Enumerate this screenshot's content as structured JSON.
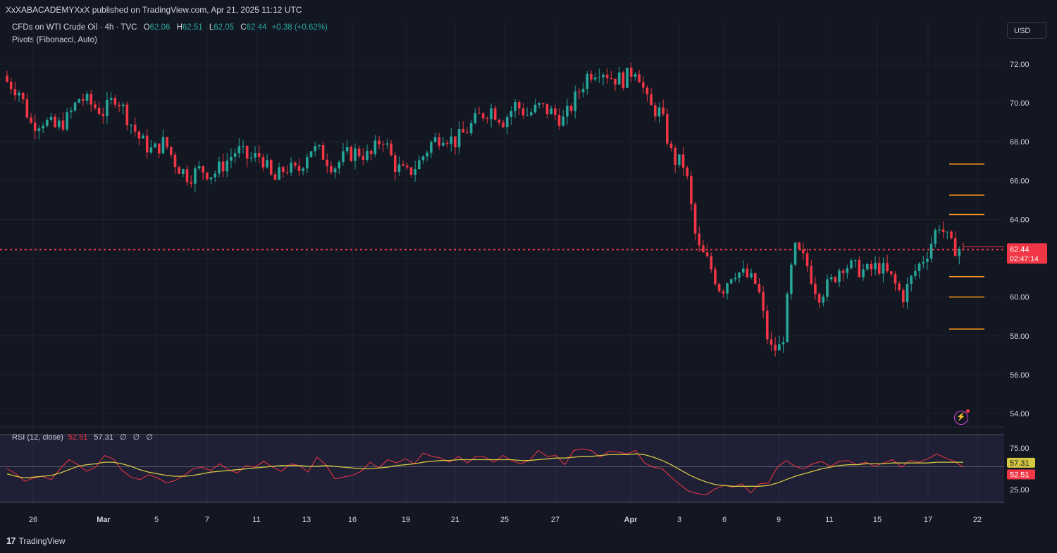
{
  "header": {
    "published": "XxXABACADEMYXxX published on TradingView.com, Apr 21, 2025 11:12 UTC"
  },
  "legend": {
    "symbol": "CFDs on WTI Crude Oil · 4h · TVC",
    "open_label": "O",
    "open": "62.06",
    "high_label": "H",
    "high": "62.51",
    "low_label": "L",
    "low": "62.05",
    "close_label": "C",
    "close": "62.44",
    "change": "+0.38 (+0.62%)",
    "pivots": "Pivots (Fibonacci, Auto)"
  },
  "currency_button": "USD",
  "price_badge": {
    "price": "62.44",
    "countdown": "02:47:14"
  },
  "rsi_legend": {
    "label": "RSI (12, close)",
    "value": "52.51",
    "ma": "57.31",
    "z1": "∅",
    "z2": "∅",
    "z3": "∅"
  },
  "brand": {
    "name": "TradingView",
    "logo_glyph": "17"
  },
  "colors": {
    "up": "#26a69a",
    "down": "#f23645",
    "pivot": "#f7931a",
    "rsi": "#f23645",
    "rsi_ma": "#d4c842",
    "background": "#131722",
    "grid": "#1e222d"
  },
  "chart_data": [
    {
      "type": "candlestick",
      "title": "CFDs on WTI Crude Oil · 4h · TVC",
      "x_ticks": [
        "26",
        "Mar",
        "5",
        "7",
        "11",
        "13",
        "16",
        "19",
        "21",
        "25",
        "27",
        "Apr",
        "3",
        "6",
        "9",
        "11",
        "15",
        "17",
        "22"
      ],
      "y_ticks": [
        "72.00",
        "70.00",
        "68.00",
        "66.00",
        "64.00",
        "62.00",
        "60.00",
        "58.00",
        "56.00",
        "54.00"
      ],
      "ylim": [
        53.4,
        73.5
      ],
      "last_price": 62.44,
      "pivot_levels": [
        66.85,
        65.25,
        64.25,
        61.05,
        60.0,
        58.35
      ],
      "series_close_path": [
        71.1,
        70.6,
        68.9,
        69.1,
        68.7,
        69.2,
        70.3,
        69.9,
        69.5,
        70.4,
        69.2,
        68.1,
        67.5,
        68.0,
        66.8,
        66.2,
        66.6,
        66.3,
        66.9,
        67.6,
        67.1,
        67.3,
        65.9,
        66.7,
        66.4,
        67.7,
        67.4,
        66.7,
        67.3,
        67.5,
        67.2,
        68.3,
        66.8,
        66.3,
        66.9,
        67.9,
        68.4,
        68.0,
        68.6,
        69.3,
        69.7,
        69.1,
        69.9,
        69.4,
        69.8,
        69.5,
        69.1,
        70.3,
        71.5,
        71.8,
        71.3,
        71.2,
        71.9,
        69.8,
        69.5,
        67.1,
        66.8,
        62.6,
        61.7,
        60.3,
        61.4,
        61.1,
        60.6,
        57.3,
        57.4,
        62.5,
        61.8,
        60.1,
        60.7,
        61.7,
        61.5,
        61.3,
        61.6,
        61.0,
        60.0,
        61.3,
        62.3,
        63.8,
        62.6,
        62.44
      ],
      "rsi": {
        "label": "RSI (12, close)",
        "y_ticks": [
          "75.00",
          "25.00"
        ],
        "ylim": [
          5,
          90
        ],
        "value": 52.51,
        "ma": 57.31,
        "values": [
          50,
          44,
          35,
          39,
          41,
          37,
          50,
          61,
          55,
          47,
          52,
          66,
          62,
          48,
          40,
          37,
          43,
          39,
          33,
          36,
          42,
          50,
          52,
          48,
          56,
          49,
          45,
          54,
          52,
          59,
          52,
          47,
          56,
          54,
          46,
          64,
          55,
          38,
          40,
          42,
          47,
          58,
          51,
          61,
          57,
          62,
          56,
          69,
          65,
          63,
          58,
          65,
          57,
          65,
          64,
          58,
          66,
          60,
          56,
          60,
          72,
          65,
          66,
          55,
          72,
          74,
          72,
          64,
          71,
          70,
          68,
          72,
          57,
          52,
          50,
          40,
          31,
          23,
          20,
          19,
          26,
          30,
          28,
          32,
          21,
          32,
          33,
          52,
          60,
          53,
          50,
          56,
          59,
          53,
          59,
          60,
          55,
          58,
          53,
          57,
          61,
          52,
          60,
          58,
          62,
          68,
          63,
          59,
          52
        ],
        "ma_values": [
          44,
          41,
          39,
          40,
          41,
          42,
          45,
          49,
          53,
          55,
          56,
          58,
          58,
          56,
          53,
          49,
          46,
          44,
          42,
          41,
          41,
          42,
          44,
          46,
          47,
          48,
          49,
          50,
          51,
          52,
          53,
          54,
          54,
          54,
          53,
          53,
          54,
          53,
          52,
          51,
          50,
          50,
          51,
          52,
          54,
          55,
          56,
          58,
          59,
          60,
          60,
          61,
          61,
          61,
          61,
          61,
          61,
          61,
          60,
          60,
          61,
          62,
          63,
          63,
          64,
          65,
          65,
          66,
          67,
          67,
          67,
          68,
          67,
          64,
          60,
          55,
          49,
          43,
          38,
          34,
          31,
          30,
          29,
          29,
          29,
          29,
          30,
          33,
          37,
          41,
          44,
          47,
          50,
          52,
          54,
          55,
          55,
          56,
          56,
          56,
          57,
          57,
          57,
          57,
          57,
          58,
          58,
          58,
          58
        ]
      }
    }
  ]
}
